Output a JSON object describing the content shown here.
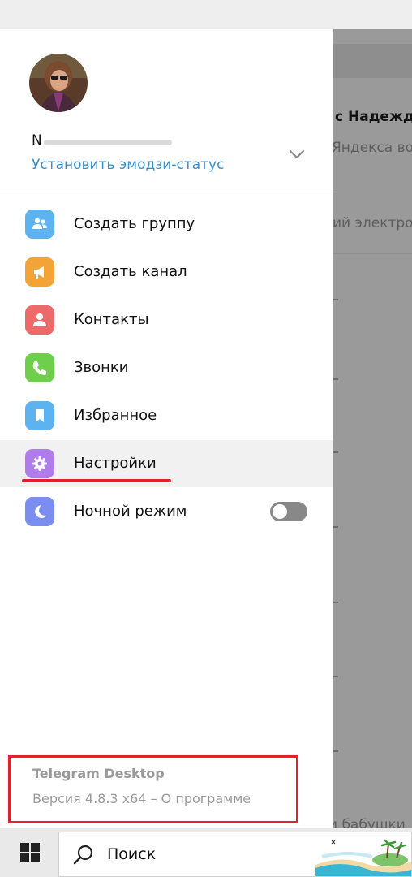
{
  "background": {
    "chat_fragments": [
      "с Надеждо",
      "Яндекса во",
      "ий электро",
      "и бабушки"
    ]
  },
  "profile": {
    "name_initial": "N",
    "emoji_status_link": "Установить эмодзи-статус"
  },
  "menu": [
    {
      "label": "Создать группу",
      "icon": "group-icon",
      "color": "#5cb3ef"
    },
    {
      "label": "Создать канал",
      "icon": "megaphone-icon",
      "color": "#f2a536"
    },
    {
      "label": "Контакты",
      "icon": "person-icon",
      "color": "#ed6a6a"
    },
    {
      "label": "Звонки",
      "icon": "phone-icon",
      "color": "#6fcf4c"
    },
    {
      "label": "Избранное",
      "icon": "bookmark-icon",
      "color": "#5cb3ef"
    },
    {
      "label": "Настройки",
      "icon": "gear-icon",
      "color": "#b07bea"
    },
    {
      "label": "Ночной режим",
      "icon": "moon-icon",
      "color": "#7b8df1"
    }
  ],
  "night_mode_on": false,
  "footer": {
    "app_name": "Telegram Desktop",
    "version": "Версия 4.8.3 x64 – О программе"
  },
  "taskbar": {
    "search_label": "Поиск"
  },
  "colors": {
    "accent": "#3a8ec8",
    "highlight": "#e0202a"
  }
}
